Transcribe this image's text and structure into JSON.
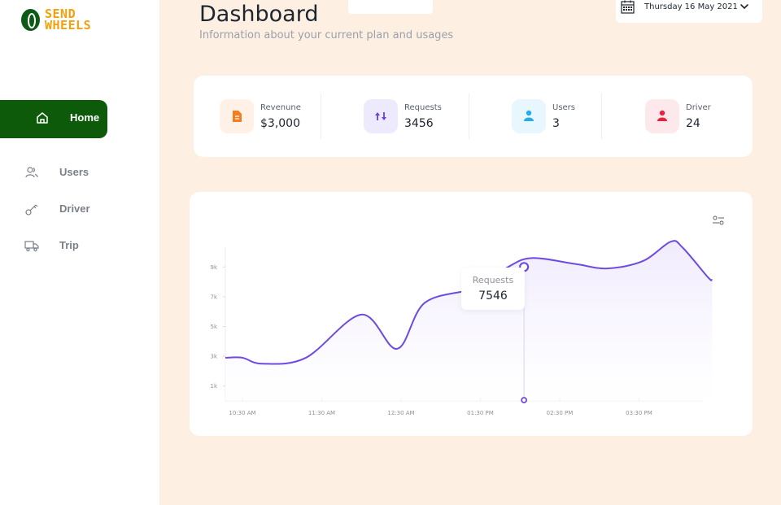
{
  "brand": {
    "line1": "SEND",
    "line2": "WHEELS"
  },
  "nav": {
    "home": {
      "label": "Home",
      "icon": "home-icon"
    },
    "items": [
      {
        "label": "Users",
        "icon": "users-icon"
      },
      {
        "label": "Driver",
        "icon": "key-icon"
      },
      {
        "label": "Trip",
        "icon": "truck-icon"
      }
    ]
  },
  "header": {
    "title": "Dashboard",
    "subtitle": "Information about your current plan and usages",
    "date": "Thursday 16 May 2021"
  },
  "stats": [
    {
      "label": "Revenune",
      "value": "$3,000",
      "icon": "document-icon",
      "color": "#f57c1f",
      "bg": "#fff1e6"
    },
    {
      "label": "Requests",
      "value": "3456",
      "icon": "sort-arrows-icon",
      "color": "#6c3fe0",
      "bg": "#eeeafd"
    },
    {
      "label": "Users",
      "value": "3",
      "icon": "user-icon",
      "color": "#25aee4",
      "bg": "#e8f6fd"
    },
    {
      "label": "Driver",
      "value": "24",
      "icon": "user-icon",
      "color": "#e8213f",
      "bg": "#fde9ec"
    }
  ],
  "tooltip": {
    "label": "Requests",
    "value": "7546"
  },
  "chart_data": {
    "type": "line",
    "y_ticks": [
      "1k",
      "3k",
      "5k",
      "7k",
      "9k"
    ],
    "x_ticks": [
      "10:30 AM",
      "11:30 AM",
      "12:30 AM",
      "01:30 PM",
      "02:30 PM",
      "03:30 PM"
    ],
    "ylim": [
      0,
      11000
    ],
    "series": [
      {
        "name": "Requests",
        "x": [
          0,
          0.25,
          0.8,
          1.5,
          1.95,
          2.3,
          2.95,
          3.35,
          3.65,
          4.2,
          4.6,
          5.05,
          5.4,
          5.55,
          5.87
        ],
        "values": [
          2900,
          2500,
          2900,
          5800,
          3500,
          6600,
          7600,
          9000,
          9600,
          9200,
          8900,
          9400,
          10700,
          10300,
          8300
        ]
      }
    ],
    "highlight": {
      "x": 3.55,
      "value": 9000
    },
    "color": "#6e4adf",
    "fill_color": "#efeafd",
    "grid": false
  }
}
